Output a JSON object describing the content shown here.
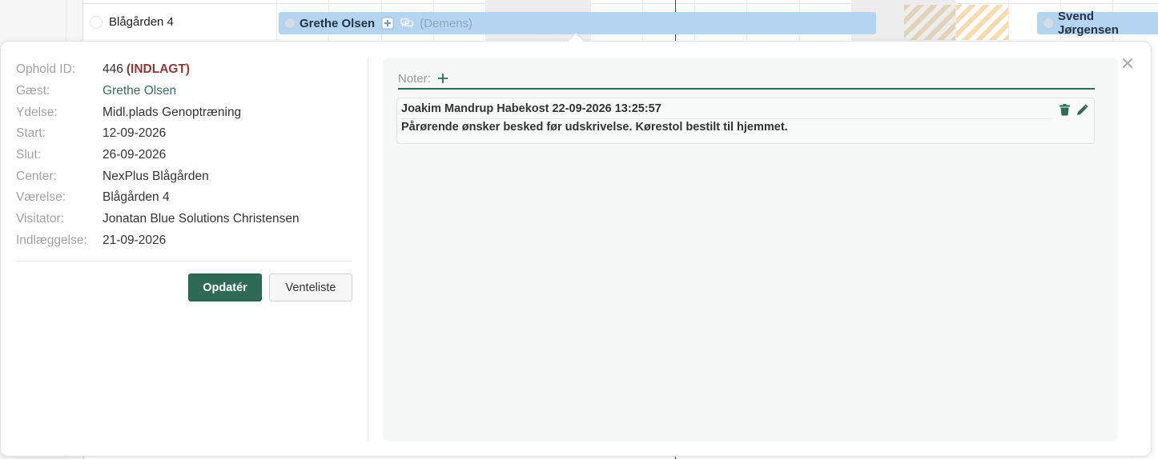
{
  "timeline": {
    "room_label": "Blågården 4",
    "stays": [
      {
        "guest": "Grethe Olsen",
        "tag": "(Demens)"
      },
      {
        "guest": "Svend Jørgensen"
      }
    ]
  },
  "popup": {
    "fields": [
      {
        "label": "Ophold ID:",
        "value": "446",
        "status": "(INDLAGT)"
      },
      {
        "label": "Gæst:",
        "value": "Grethe Olsen"
      },
      {
        "label": "Ydelse:",
        "value": "Midl.plads Genoptræning"
      },
      {
        "label": "Start:",
        "value": "12-09-2026"
      },
      {
        "label": "Slut:",
        "value": "26-09-2026"
      },
      {
        "label": "Center:",
        "value": "NexPlus Blågården"
      },
      {
        "label": "Værelse:",
        "value": "Blågården 4"
      },
      {
        "label": "Visitator:",
        "value": "Jonatan Blue Solutions Christensen"
      },
      {
        "label": "Indlæggelse:",
        "value": "21-09-2026"
      }
    ],
    "buttons": {
      "update": "Opdatér",
      "waitlist": "Venteliste"
    },
    "notes": {
      "title": "Noter:",
      "items": [
        {
          "meta": "Joakim Mandrup Habekost 22-09-2026 13:25:57",
          "text": "Pårørende ønsker besked før udskrivelse. Kørestol bestilt til hjemmet."
        }
      ]
    }
  },
  "colors": {
    "accent": "#2d6b57",
    "status": "#8b3a3a",
    "stay_bar": "#b5d4ef"
  }
}
